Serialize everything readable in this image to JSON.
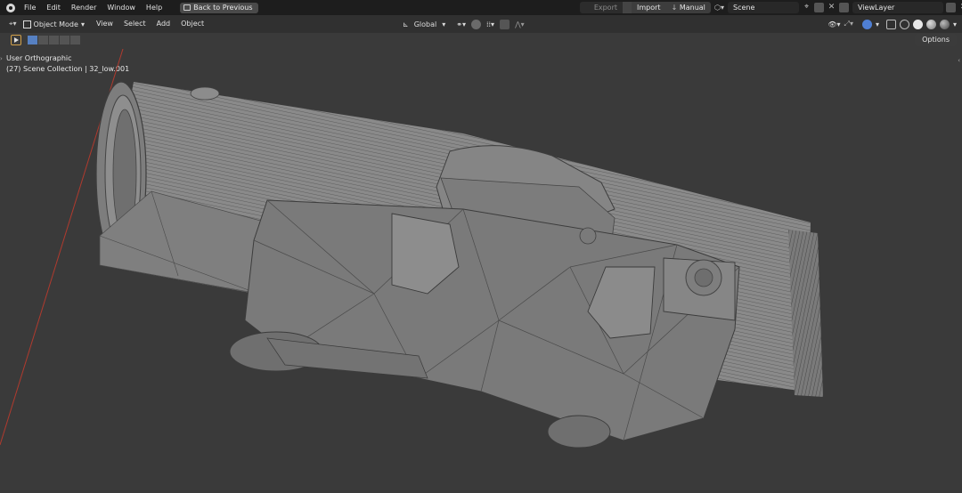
{
  "topbar": {
    "menus": [
      "File",
      "Edit",
      "Render",
      "Window",
      "Help"
    ],
    "back_button": "Back to Previous",
    "export_label": "Export",
    "import_label": "Import",
    "manual_label": "Manual",
    "scene_name": "Scene",
    "view_layer": "ViewLayer"
  },
  "header": {
    "mode": "Object Mode",
    "menus": [
      "View",
      "Select",
      "Add",
      "Object"
    ],
    "orientation": "Global",
    "options_label": "Options"
  },
  "viewport": {
    "view_name": "User Orthographic",
    "collection_info": "(27) Scene Collection | 32_low.001"
  },
  "colors": {
    "topbar_bg": "#1d1d1d",
    "header_bg": "#303030",
    "viewport_bg": "#3a3a3a",
    "selection_blue": "#5680c2",
    "x_axis": "#c0392b"
  },
  "icons": [
    "blender-logo-icon",
    "cursor-select-icon",
    "transform-orientation-icon",
    "snap-icon",
    "proportional-icon",
    "visibility-icon",
    "gizmo-icon",
    "overlay-icon",
    "xray-icon",
    "shading-wire-icon",
    "shading-solid-icon",
    "shading-material-icon",
    "shading-rendered-icon"
  ]
}
